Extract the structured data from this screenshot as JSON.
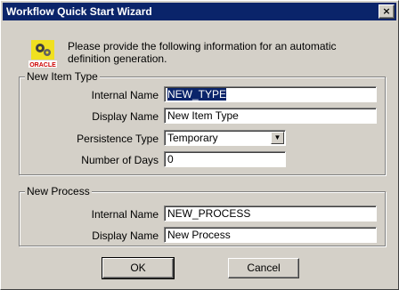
{
  "window": {
    "title": "Workflow Quick Start Wizard",
    "close_label": "×"
  },
  "logo": {
    "text": "ORACLE"
  },
  "intro_text": "Please provide the following information for an automatic definition generation.",
  "item_type": {
    "group_label": "New Item Type",
    "internal_name_label": "Internal Name",
    "internal_name_value": "NEW_TYPE",
    "display_name_label": "Display Name",
    "display_name_value": "New Item Type",
    "persistence_label": "Persistence Type",
    "persistence_value": "Temporary",
    "days_label": "Number of Days",
    "days_value": "0"
  },
  "process": {
    "group_label": "New Process",
    "internal_name_label": "Internal Name",
    "internal_name_value": "NEW_PROCESS",
    "display_name_label": "Display Name",
    "display_name_value": "New Process"
  },
  "buttons": {
    "ok": "OK",
    "cancel": "Cancel"
  }
}
